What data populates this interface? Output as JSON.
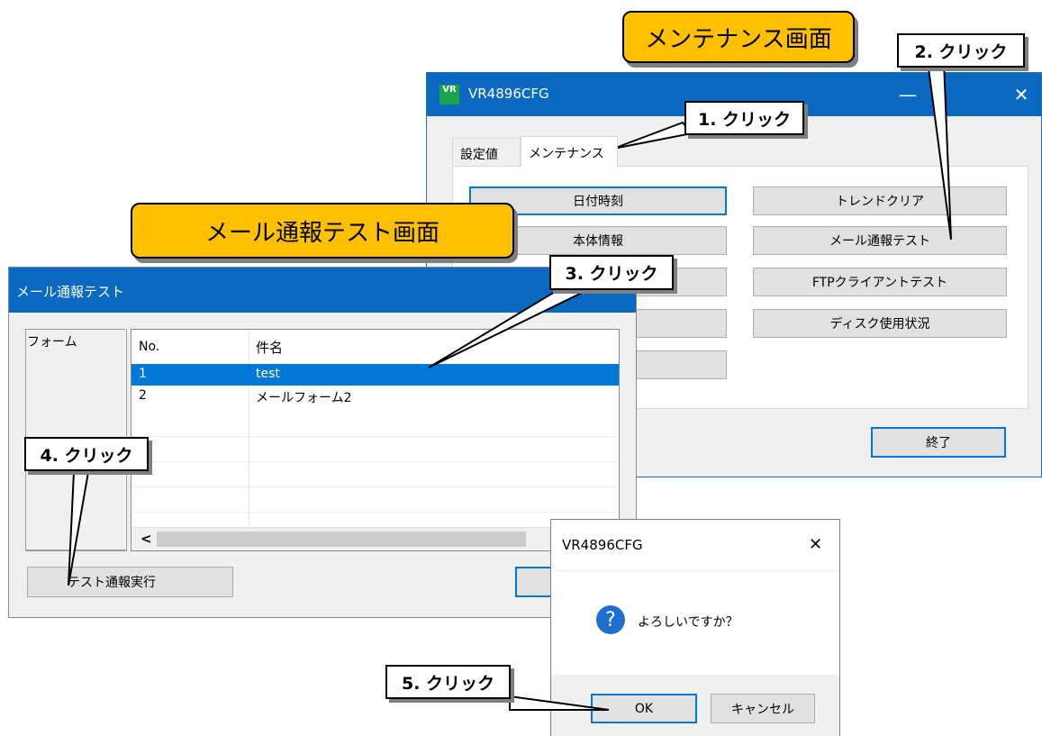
{
  "labels": {
    "maintenance_screen": "メンテナンス画面",
    "mail_test_screen": "メール通報テスト画面"
  },
  "callouts": {
    "step1": "1. クリック",
    "step2": "2. クリック",
    "step3": "3. クリック",
    "step4": "4. クリック",
    "step5": "5. クリック"
  },
  "main_window": {
    "title": "VR4896CFG",
    "app_icon": "VR",
    "tabs": [
      {
        "label": "設定値",
        "selected": false
      },
      {
        "label": "メンテナンス",
        "selected": true
      }
    ],
    "left_buttons": [
      "日付時刻",
      "本体情報"
    ],
    "right_buttons": [
      "トレンドクリア",
      "メール通報テスト",
      "FTPクライアントテスト",
      "ディスク使用状況"
    ],
    "exit_button": "終了",
    "minimize_icon": "minimize-icon",
    "close_icon": "close-icon"
  },
  "mail_window": {
    "title": "メール通報テスト",
    "group_label": "フォーム",
    "columns": [
      "No.",
      "件名"
    ],
    "rows": [
      {
        "no": "1",
        "subject": "test",
        "selected": true
      },
      {
        "no": "2",
        "subject": "メールフォーム2",
        "selected": false
      }
    ],
    "scroll_left": "<",
    "run_button": "テスト通報実行"
  },
  "confirm_dialog": {
    "title": "VR4896CFG",
    "message": "よろしいですか？",
    "question_glyph": "?",
    "ok_button": "OK",
    "cancel_button": "キャンセル",
    "close_glyph": "✕"
  },
  "colors": {
    "accent": "#0078d7",
    "titlebar": "#0a6ac2",
    "callout_fill": "#ffc000"
  }
}
